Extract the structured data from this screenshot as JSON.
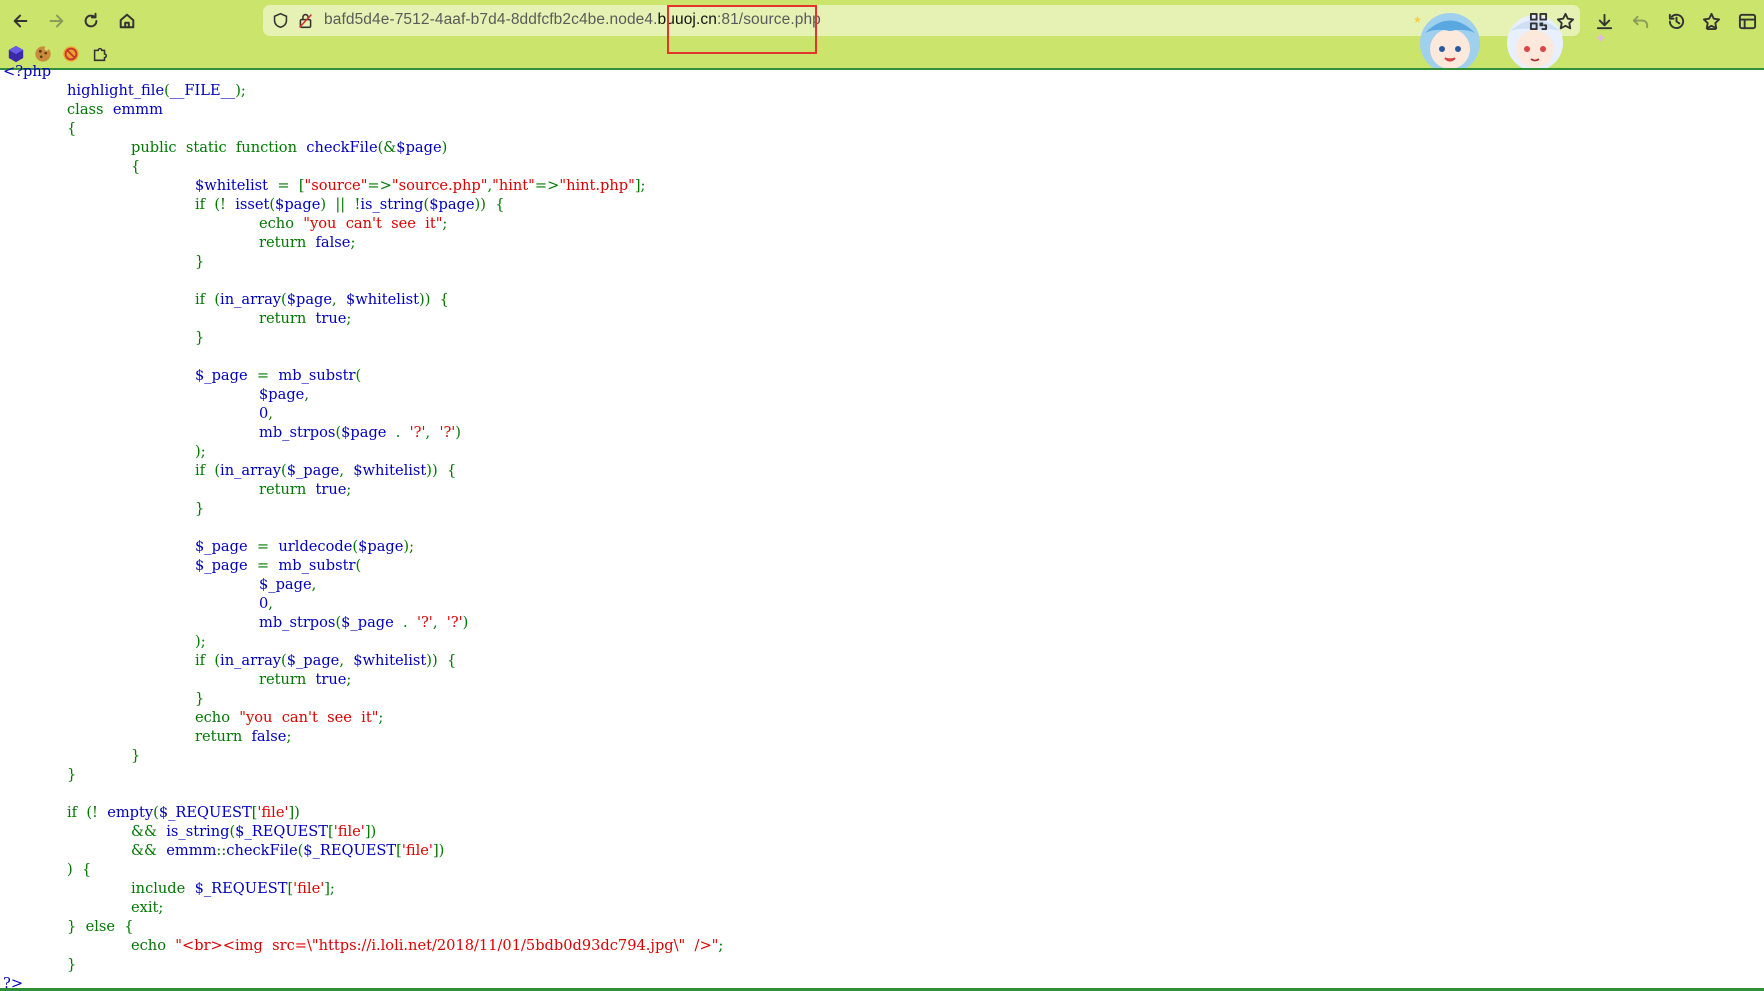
{
  "browser": {
    "url_prefix": "bafd5d4e-7512-4aaf-b7d4-8ddfcfb2c4be.node4.",
    "url_domain": "buuoj.cn",
    "url_suffix": ":81/source.php",
    "theme_color": "#cbe46b",
    "urlbar_color": "#e6f2b3",
    "highlight_color": "#e3352b"
  },
  "toolbar_icons": [
    "back-icon",
    "forward-icon",
    "reload-icon",
    "home-icon",
    "shield-icon",
    "lock-icon",
    "qr-code-icon",
    "star-icon",
    "download-icon",
    "undo-icon",
    "history-icon",
    "favorites-icon",
    "sidebar-icon"
  ],
  "extensions": [
    "hexagon-extension-icon",
    "cookie-extension-icon",
    "blocker-extension-icon",
    "puzzle-extension-icon"
  ],
  "source_lines": [
    {
      "indent": 0,
      "tokens": [
        {
          "c": "kw",
          "t": "<?php"
        }
      ]
    },
    {
      "indent": 1,
      "tokens": [
        {
          "c": "kw",
          "t": "highlight_file"
        },
        {
          "c": "pun",
          "t": "("
        },
        {
          "c": "kw",
          "t": "__FILE__"
        },
        {
          "c": "pun",
          "t": ");"
        }
      ]
    },
    {
      "indent": 1,
      "tokens": [
        {
          "c": "pun",
          "t": "class  "
        },
        {
          "c": "kw",
          "t": "emmm"
        }
      ]
    },
    {
      "indent": 1,
      "tokens": [
        {
          "c": "pun",
          "t": "{"
        }
      ]
    },
    {
      "indent": 2,
      "tokens": [
        {
          "c": "pun",
          "t": "public  static  function  "
        },
        {
          "c": "kw",
          "t": "checkFile"
        },
        {
          "c": "pun",
          "t": "(&"
        },
        {
          "c": "kw",
          "t": "$page"
        },
        {
          "c": "pun",
          "t": ")"
        }
      ]
    },
    {
      "indent": 2,
      "tokens": [
        {
          "c": "pun",
          "t": "{"
        }
      ]
    },
    {
      "indent": 3,
      "tokens": [
        {
          "c": "kw",
          "t": "$whitelist  "
        },
        {
          "c": "pun",
          "t": "=  ["
        },
        {
          "c": "str",
          "t": "\"source\""
        },
        {
          "c": "pun",
          "t": "=>"
        },
        {
          "c": "str",
          "t": "\"source.php\""
        },
        {
          "c": "pun",
          "t": ","
        },
        {
          "c": "str",
          "t": "\"hint\""
        },
        {
          "c": "pun",
          "t": "=>"
        },
        {
          "c": "str",
          "t": "\"hint.php\""
        },
        {
          "c": "pun",
          "t": "];"
        }
      ]
    },
    {
      "indent": 3,
      "tokens": [
        {
          "c": "pun",
          "t": "if  (!  "
        },
        {
          "c": "kw",
          "t": "isset"
        },
        {
          "c": "pun",
          "t": "("
        },
        {
          "c": "kw",
          "t": "$page"
        },
        {
          "c": "pun",
          "t": ")  ||  !"
        },
        {
          "c": "kw",
          "t": "is_string"
        },
        {
          "c": "pun",
          "t": "("
        },
        {
          "c": "kw",
          "t": "$page"
        },
        {
          "c": "pun",
          "t": "))  {"
        }
      ]
    },
    {
      "indent": 4,
      "tokens": [
        {
          "c": "pun",
          "t": "echo  "
        },
        {
          "c": "str",
          "t": "\"you  can't  see  it\""
        },
        {
          "c": "pun",
          "t": ";"
        }
      ]
    },
    {
      "indent": 4,
      "tokens": [
        {
          "c": "pun",
          "t": "return  "
        },
        {
          "c": "kw",
          "t": "false"
        },
        {
          "c": "pun",
          "t": ";"
        }
      ]
    },
    {
      "indent": 3,
      "tokens": [
        {
          "c": "pun",
          "t": "}"
        }
      ]
    },
    {
      "indent": 0,
      "tokens": []
    },
    {
      "indent": 3,
      "tokens": [
        {
          "c": "pun",
          "t": "if  ("
        },
        {
          "c": "kw",
          "t": "in_array"
        },
        {
          "c": "pun",
          "t": "("
        },
        {
          "c": "kw",
          "t": "$page"
        },
        {
          "c": "pun",
          "t": ",  "
        },
        {
          "c": "kw",
          "t": "$whitelist"
        },
        {
          "c": "pun",
          "t": "))  {"
        }
      ]
    },
    {
      "indent": 4,
      "tokens": [
        {
          "c": "pun",
          "t": "return  "
        },
        {
          "c": "kw",
          "t": "true"
        },
        {
          "c": "pun",
          "t": ";"
        }
      ]
    },
    {
      "indent": 3,
      "tokens": [
        {
          "c": "pun",
          "t": "}"
        }
      ]
    },
    {
      "indent": 0,
      "tokens": []
    },
    {
      "indent": 3,
      "tokens": [
        {
          "c": "kw",
          "t": "$_page  "
        },
        {
          "c": "pun",
          "t": "=  "
        },
        {
          "c": "kw",
          "t": "mb_substr"
        },
        {
          "c": "pun",
          "t": "("
        }
      ]
    },
    {
      "indent": 4,
      "tokens": [
        {
          "c": "kw",
          "t": "$page"
        },
        {
          "c": "pun",
          "t": ","
        }
      ]
    },
    {
      "indent": 4,
      "tokens": [
        {
          "c": "kw",
          "t": "0"
        },
        {
          "c": "pun",
          "t": ","
        }
      ]
    },
    {
      "indent": 4,
      "tokens": [
        {
          "c": "kw",
          "t": "mb_strpos"
        },
        {
          "c": "pun",
          "t": "("
        },
        {
          "c": "kw",
          "t": "$page  "
        },
        {
          "c": "pun",
          "t": ".  "
        },
        {
          "c": "str",
          "t": "'?'"
        },
        {
          "c": "pun",
          "t": ",  "
        },
        {
          "c": "str",
          "t": "'?'"
        },
        {
          "c": "pun",
          "t": ")"
        }
      ]
    },
    {
      "indent": 3,
      "tokens": [
        {
          "c": "pun",
          "t": ");"
        }
      ]
    },
    {
      "indent": 3,
      "tokens": [
        {
          "c": "pun",
          "t": "if  ("
        },
        {
          "c": "kw",
          "t": "in_array"
        },
        {
          "c": "pun",
          "t": "("
        },
        {
          "c": "kw",
          "t": "$_page"
        },
        {
          "c": "pun",
          "t": ",  "
        },
        {
          "c": "kw",
          "t": "$whitelist"
        },
        {
          "c": "pun",
          "t": "))  {"
        }
      ]
    },
    {
      "indent": 4,
      "tokens": [
        {
          "c": "pun",
          "t": "return  "
        },
        {
          "c": "kw",
          "t": "true"
        },
        {
          "c": "pun",
          "t": ";"
        }
      ]
    },
    {
      "indent": 3,
      "tokens": [
        {
          "c": "pun",
          "t": "}"
        }
      ]
    },
    {
      "indent": 0,
      "tokens": []
    },
    {
      "indent": 3,
      "tokens": [
        {
          "c": "kw",
          "t": "$_page  "
        },
        {
          "c": "pun",
          "t": "=  "
        },
        {
          "c": "kw",
          "t": "urldecode"
        },
        {
          "c": "pun",
          "t": "("
        },
        {
          "c": "kw",
          "t": "$page"
        },
        {
          "c": "pun",
          "t": ");"
        }
      ]
    },
    {
      "indent": 3,
      "tokens": [
        {
          "c": "kw",
          "t": "$_page  "
        },
        {
          "c": "pun",
          "t": "=  "
        },
        {
          "c": "kw",
          "t": "mb_substr"
        },
        {
          "c": "pun",
          "t": "("
        }
      ]
    },
    {
      "indent": 4,
      "tokens": [
        {
          "c": "kw",
          "t": "$_page"
        },
        {
          "c": "pun",
          "t": ","
        }
      ]
    },
    {
      "indent": 4,
      "tokens": [
        {
          "c": "kw",
          "t": "0"
        },
        {
          "c": "pun",
          "t": ","
        }
      ]
    },
    {
      "indent": 4,
      "tokens": [
        {
          "c": "kw",
          "t": "mb_strpos"
        },
        {
          "c": "pun",
          "t": "("
        },
        {
          "c": "kw",
          "t": "$_page  "
        },
        {
          "c": "pun",
          "t": ".  "
        },
        {
          "c": "str",
          "t": "'?'"
        },
        {
          "c": "pun",
          "t": ",  "
        },
        {
          "c": "str",
          "t": "'?'"
        },
        {
          "c": "pun",
          "t": ")"
        }
      ]
    },
    {
      "indent": 3,
      "tokens": [
        {
          "c": "pun",
          "t": ");"
        }
      ]
    },
    {
      "indent": 3,
      "tokens": [
        {
          "c": "pun",
          "t": "if  ("
        },
        {
          "c": "kw",
          "t": "in_array"
        },
        {
          "c": "pun",
          "t": "("
        },
        {
          "c": "kw",
          "t": "$_page"
        },
        {
          "c": "pun",
          "t": ",  "
        },
        {
          "c": "kw",
          "t": "$whitelist"
        },
        {
          "c": "pun",
          "t": "))  {"
        }
      ]
    },
    {
      "indent": 4,
      "tokens": [
        {
          "c": "pun",
          "t": "return  "
        },
        {
          "c": "kw",
          "t": "true"
        },
        {
          "c": "pun",
          "t": ";"
        }
      ]
    },
    {
      "indent": 3,
      "tokens": [
        {
          "c": "pun",
          "t": "}"
        }
      ]
    },
    {
      "indent": 3,
      "tokens": [
        {
          "c": "pun",
          "t": "echo  "
        },
        {
          "c": "str",
          "t": "\"you  can't  see  it\""
        },
        {
          "c": "pun",
          "t": ";"
        }
      ]
    },
    {
      "indent": 3,
      "tokens": [
        {
          "c": "pun",
          "t": "return  "
        },
        {
          "c": "kw",
          "t": "false"
        },
        {
          "c": "pun",
          "t": ";"
        }
      ]
    },
    {
      "indent": 2,
      "tokens": [
        {
          "c": "pun",
          "t": "}"
        }
      ]
    },
    {
      "indent": 1,
      "tokens": [
        {
          "c": "pun",
          "t": "}"
        }
      ]
    },
    {
      "indent": 0,
      "tokens": []
    },
    {
      "indent": 1,
      "tokens": [
        {
          "c": "pun",
          "t": "if  (!  "
        },
        {
          "c": "kw",
          "t": "empty"
        },
        {
          "c": "pun",
          "t": "("
        },
        {
          "c": "kw",
          "t": "$_REQUEST"
        },
        {
          "c": "pun",
          "t": "["
        },
        {
          "c": "str",
          "t": "'file'"
        },
        {
          "c": "pun",
          "t": "])"
        }
      ]
    },
    {
      "indent": 2,
      "tokens": [
        {
          "c": "pun",
          "t": "&&  "
        },
        {
          "c": "kw",
          "t": "is_string"
        },
        {
          "c": "pun",
          "t": "("
        },
        {
          "c": "kw",
          "t": "$_REQUEST"
        },
        {
          "c": "pun",
          "t": "["
        },
        {
          "c": "str",
          "t": "'file'"
        },
        {
          "c": "pun",
          "t": "])"
        }
      ]
    },
    {
      "indent": 2,
      "tokens": [
        {
          "c": "pun",
          "t": "&&  "
        },
        {
          "c": "kw",
          "t": "emmm"
        },
        {
          "c": "pun",
          "t": "::"
        },
        {
          "c": "kw",
          "t": "checkFile"
        },
        {
          "c": "pun",
          "t": "("
        },
        {
          "c": "kw",
          "t": "$_REQUEST"
        },
        {
          "c": "pun",
          "t": "["
        },
        {
          "c": "str",
          "t": "'file'"
        },
        {
          "c": "pun",
          "t": "])"
        }
      ]
    },
    {
      "indent": 1,
      "tokens": [
        {
          "c": "pun",
          "t": ")  {"
        }
      ]
    },
    {
      "indent": 2,
      "tokens": [
        {
          "c": "pun",
          "t": "include  "
        },
        {
          "c": "kw",
          "t": "$_REQUEST"
        },
        {
          "c": "pun",
          "t": "["
        },
        {
          "c": "str",
          "t": "'file'"
        },
        {
          "c": "pun",
          "t": "];"
        }
      ]
    },
    {
      "indent": 2,
      "tokens": [
        {
          "c": "pun",
          "t": "exit;"
        }
      ]
    },
    {
      "indent": 1,
      "tokens": [
        {
          "c": "pun",
          "t": "}  else  {"
        }
      ]
    },
    {
      "indent": 2,
      "tokens": [
        {
          "c": "pun",
          "t": "echo  "
        },
        {
          "c": "str",
          "t": "\"<br><img  src=\\\"https://i.loli.net/2018/11/01/5bdb0d93dc794.jpg\\\"  />\""
        },
        {
          "c": "pun",
          "t": ";"
        }
      ]
    },
    {
      "indent": 1,
      "tokens": [
        {
          "c": "pun",
          "t": "}"
        }
      ]
    },
    {
      "indent": 0,
      "tokens": [
        {
          "c": "kw",
          "t": "?>"
        }
      ]
    }
  ]
}
